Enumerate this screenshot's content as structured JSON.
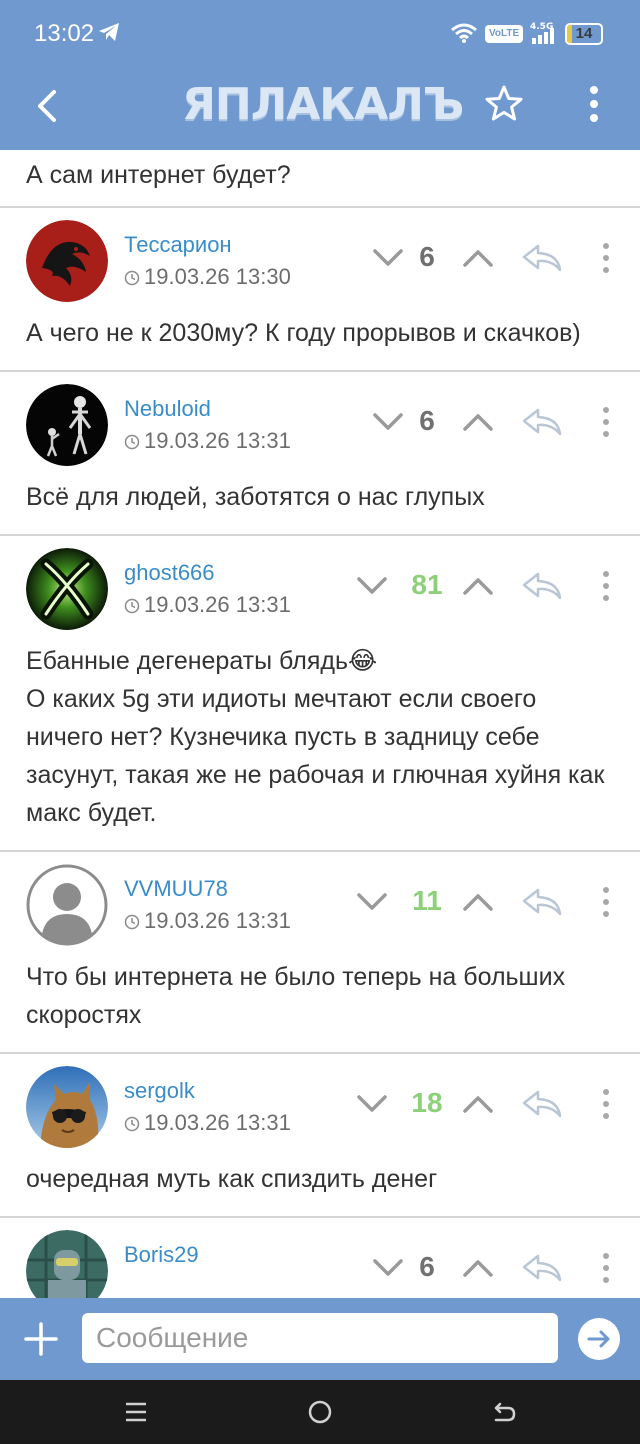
{
  "status_bar": {
    "time": "13:02",
    "volte": "VoLTE",
    "network": "4.5G",
    "battery": "14",
    "battery_level": 0.14
  },
  "header": {
    "logo": "ЯПЛАКАЛЪ",
    "icons": [
      "back-arrow-icon",
      "star-icon",
      "more-vertical-icon"
    ]
  },
  "previous_comment_tail": "А сам интернет будет?",
  "comments": [
    {
      "author": "Тессарион",
      "datetime": "19.03.26 13:30",
      "score": "6",
      "score_positive": false,
      "text": "А чего не к 2030му? К году прорывов и скачков)"
    },
    {
      "author": "Nebuloid",
      "datetime": "19.03.26 13:31",
      "score": "6",
      "score_positive": false,
      "text": "Всё для людей, заботятся о нас глупых"
    },
    {
      "author": "ghost666",
      "datetime": "19.03.26 13:31",
      "score": "81",
      "score_positive": true,
      "text": "Ебанные дегенераты блядь😂\nО каких 5g эти идиоты мечтают если своего ничего нет? Кузнечика пусть в задницу себе засунут, такая же не рабочая и глючная хуйня как макс будет."
    },
    {
      "author": "VVMUU78",
      "datetime": "19.03.26 13:31",
      "score": "11",
      "score_positive": true,
      "text": "Что бы интернета не было теперь на больших скоростях"
    },
    {
      "author": "sergolk",
      "datetime": "19.03.26 13:31",
      "score": "18",
      "score_positive": true,
      "text": "очередная муть как спиздить денег"
    },
    {
      "author": "Boris29",
      "datetime": "",
      "score": "6",
      "score_positive": false,
      "text": ""
    }
  ],
  "composer": {
    "placeholder": "Сообщение"
  },
  "colors": {
    "header_bg": "#6f99cf",
    "author_link": "#3a8cc9",
    "score_positive": "#8cd07a",
    "score_neutral": "#707070",
    "divider": "#d6d6d6",
    "system_nav_bg": "#1b1b1b"
  }
}
